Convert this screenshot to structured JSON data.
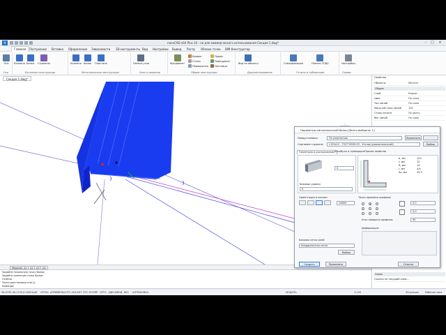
{
  "app": {
    "title": "nanoCAD x64 Plus 20 - не для коммерческого использования Секция 1.dwg*",
    "logo": "N"
  },
  "tabs": [
    "Главная",
    "Построение",
    "Вставка",
    "Оформление",
    "Зависимости",
    "3D-инструменты",
    "Вид",
    "Настройки",
    "Вывод",
    "Растр",
    "Облака точек",
    "BIM Конструктор"
  ],
  "ribbon": {
    "buttons": [
      {
        "label": "Оси",
        "color": "#5b7da8"
      },
      {
        "label": "Колонна",
        "color": "#3c6fc4"
      },
      {
        "label": "Балка",
        "color": "#3c6fc4"
      },
      {
        "label": "Стропила",
        "color": "#7c5fb0"
      },
      {
        "label": "Колонна",
        "color": "#3c6fc4"
      },
      {
        "label": "Балка",
        "color": "#3c6fc4"
      },
      {
        "label": "Пластина",
        "color": "#3c6fc4"
      },
      {
        "label": "Панель узла",
        "color": "#5d6f86"
      },
      {
        "label": "Фундамент",
        "color": "#7a8f5a"
      },
      {
        "label": "Вид по объекту",
        "color": "#3d6db5"
      },
      {
        "label": "Спецификация",
        "color": "#4a78b8"
      },
      {
        "label": "Панель СПДС",
        "color": "#4a78b8"
      },
      {
        "label": "Настройки",
        "color": "#7b8594"
      }
    ],
    "small": [
      "Кровля",
      "Стены",
      "Перекрытия",
      "Проем",
      "Помещение",
      "Лестница"
    ],
    "groups": [
      "Оси",
      "Бетонные конструкции",
      "Металлические конструкции",
      "Узлы и решения",
      "Общие конструкции",
      "Документирование",
      "Отчеты и публикация",
      "Сервис"
    ]
  },
  "document": {
    "tab": "Секция 1.dwg*",
    "hint1": "Пользовательский вид",
    "hint2": "Точный стиль видов"
  },
  "model_tabs": [
    "Модель",
    "A1",
    "A2",
    "A3",
    "A4"
  ],
  "command_lines": [
    "Задайте начальную точку балки:",
    "Задайте конечную точку балки:",
    "Отмена",
    "Точка расстановки или []:",
    "Команда:"
  ],
  "status": {
    "coords": "96.0795,36.1135,0.0000",
    "toggles": [
      "ШАГ",
      "СЕТКА",
      "оПРИВЯЗКА",
      "ОТС-ОБЪЕКТ",
      "ОТС-ПОЛЯР",
      "ОРТО",
      "ДИН-ВВОД",
      "ВЕС",
      "ШТРИХОВКА"
    ],
    "model": "МОДЕЛЬ",
    "scale": "1:100",
    "mode3d": "3D-режим",
    "layer_text": "Рабочая зона"
  },
  "properties": {
    "title": "Свойства",
    "objects_label": "Объекты",
    "objects_value": "Металл",
    "section": "Общие",
    "rows": [
      {
        "k": "Слой",
        "v": "Каркас"
      },
      {
        "k": "Цвет",
        "v": "По слою"
      },
      {
        "k": "Тип линий",
        "v": "По слою"
      },
      {
        "k": "Масштаб типа линий",
        "v": "100"
      },
      {
        "k": "Стиль печати",
        "v": "По цвету"
      },
      {
        "k": "Вес линий",
        "v": "По слою"
      }
    ],
    "bottom_section": "Связи",
    "bottom_row": "Ссылка на текущий элем..."
  },
  "dialog": {
    "title": "Параметры металлической балки [Всего выбрано: 1]",
    "preset_label": "Предустановки:",
    "preset_value": "По умолчанию",
    "apply_btn": "Применить",
    "assort_label": "Сортамент проката:",
    "assort_value": "L125x12 - ГОСТ 8509-93 - Уголок (равнополочный)",
    "choose_btn": "Выбор",
    "tabs": [
      "Геометрия и расположение",
      "Атрибуты и нумерация",
      "Прочие свойства"
    ],
    "rotation_value": "0",
    "base_levels": "Базовые уровни",
    "base_value": "0",
    "profile_params": [
      {
        "k": "b, мм",
        "v": "125"
      },
      {
        "k": "t, мм",
        "v": "12"
      },
      {
        "k": "R, мм",
        "v": "14"
      },
      {
        "k": "r, мм",
        "v": "4,6"
      },
      {
        "k": "Xo, мм",
        "v": "35,3"
      }
    ],
    "orient_label": "Ориентация и наклон:",
    "orient_value": "24600",
    "anchor_label": "Точка привязки профиля:",
    "offset1": "0,0",
    "offset2": "0,0",
    "angle_label": "Угол поворота профиля:",
    "angle_value": "90",
    "deform_label": "Деформация:",
    "base_grid_label": "Базовая сетка осей:",
    "base_grid_value": "Координатная сетка",
    "pick_btn": "Выбор",
    "create_btn": "Создать",
    "apply2_btn": "Применить",
    "cancel_btn": "Отмена"
  },
  "colors": {
    "beam": "#1a3cf0",
    "beam_dark": "#0f24c8",
    "line_blue": "#3a3ae8",
    "line_magenta": "#c23cc2"
  }
}
